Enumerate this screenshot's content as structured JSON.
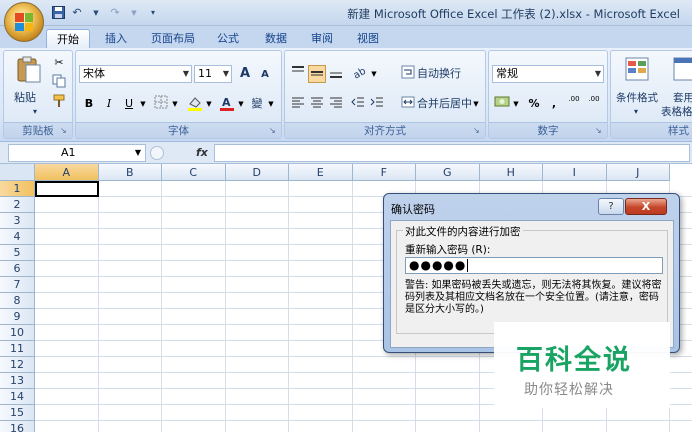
{
  "window": {
    "title": "新建 Microsoft Office Excel 工作表 (2).xlsx - Microsoft Excel"
  },
  "tabs": [
    {
      "label": "开始",
      "active": true
    },
    {
      "label": "插入"
    },
    {
      "label": "页面布局"
    },
    {
      "label": "公式"
    },
    {
      "label": "数据"
    },
    {
      "label": "审阅"
    },
    {
      "label": "视图"
    }
  ],
  "ribbon": {
    "clipboard": {
      "paste_label": "粘贴",
      "group_label": "剪贴板"
    },
    "font": {
      "font_name": "宋体",
      "font_size": "11",
      "bold": "B",
      "italic": "I",
      "underline": "U",
      "grow": "A",
      "shrink": "A",
      "phonetic": "變",
      "group_label": "字体"
    },
    "alignment": {
      "wrap_text": "自动换行",
      "merge_center": "合并后居中",
      "group_label": "对齐方式"
    },
    "number": {
      "format": "常规",
      "percent": "%",
      "comma": ",",
      "inc_decimal": ".00",
      "dec_decimal": ".00",
      "group_label": "数字"
    },
    "styles": {
      "conditional_format": "条件格式",
      "table_format": "套用",
      "table_format2": "表格格",
      "group_label": "样式"
    }
  },
  "formula_bar": {
    "name_box": "A1",
    "fx": "fx",
    "value": ""
  },
  "sheet": {
    "columns": [
      "A",
      "B",
      "C",
      "D",
      "E",
      "F",
      "G",
      "H",
      "I",
      "J"
    ],
    "rows": [
      "1",
      "2",
      "3",
      "4",
      "5",
      "6",
      "7",
      "8",
      "9",
      "10",
      "11",
      "12",
      "13",
      "14",
      "15",
      "16"
    ],
    "active_cell": "A1"
  },
  "dialog": {
    "title": "确认密码",
    "help": "?",
    "close": "X",
    "legend": "对此文件的内容进行加密",
    "label": "重新输入密码 (R):",
    "password_masked": "●●●●●",
    "warning": "警告: 如果密码被丢失或遗忘，则无法将其恢复。建议将密码列表及其相应文档名放在一个安全位置。(请注意，密码是区分大小写的。)"
  },
  "watermark": {
    "title": "百科全说",
    "subtitle": "助你轻松解决"
  },
  "colors": {
    "accent": "#15428b",
    "close_button": "#c7472a",
    "watermark_green": "#1aa463"
  }
}
